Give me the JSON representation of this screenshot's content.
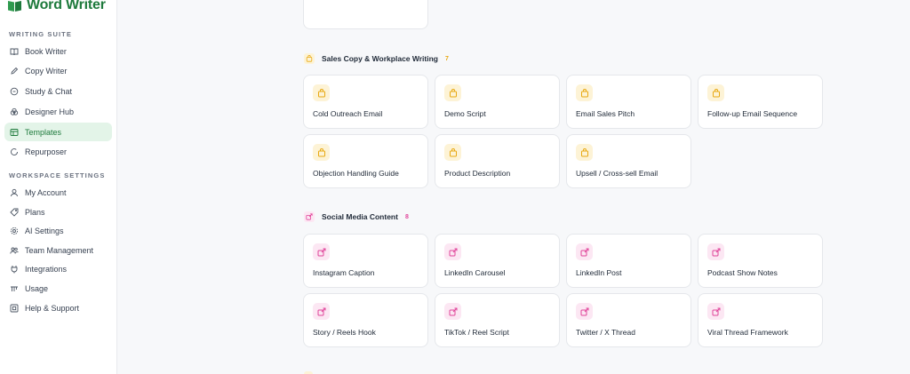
{
  "app": {
    "name": "Word Writer"
  },
  "sidebar": {
    "writing_suite_title": "WRITING SUITE",
    "writing_items": [
      {
        "label": "Book Writer",
        "icon": "book-icon"
      },
      {
        "label": "Copy Writer",
        "icon": "pen-icon"
      },
      {
        "label": "Study & Chat",
        "icon": "chat-icon"
      },
      {
        "label": "Designer Hub",
        "icon": "palette-icon"
      },
      {
        "label": "Templates",
        "icon": "template-icon",
        "active": true
      },
      {
        "label": "Repurposer",
        "icon": "refresh-icon"
      }
    ],
    "workspace_title": "WORKSPACE SETTINGS",
    "workspace_items": [
      {
        "label": "My Account",
        "icon": "user-icon"
      },
      {
        "label": "Plans",
        "icon": "tag-icon"
      },
      {
        "label": "AI Settings",
        "icon": "gear-icon"
      },
      {
        "label": "Team Management",
        "icon": "team-icon"
      },
      {
        "label": "Integrations",
        "icon": "plug-icon"
      },
      {
        "label": "Usage",
        "icon": "usage-icon"
      },
      {
        "label": "Help & Support",
        "icon": "help-icon"
      }
    ]
  },
  "sections": {
    "sales": {
      "title": "Sales Copy & Workplace Writing",
      "count": "7",
      "color": "#e8a812",
      "icon": "bag-icon",
      "items": [
        "Cold Outreach Email",
        "Demo Script",
        "Email Sales Pitch",
        "Follow-up Email Sequence",
        "Objection Handling Guide",
        "Product Description",
        "Upsell / Cross-sell Email"
      ]
    },
    "social": {
      "title": "Social Media Content",
      "count": "8",
      "color": "#e0449a",
      "icon": "share-icon",
      "items": [
        "Instagram Caption",
        "LinkedIn Carousel",
        "LinkedIn Post",
        "Podcast Show Notes",
        "Story / Reels Hook",
        "TikTok / Reel Script",
        "Twitter / X Thread",
        "Viral Thread Framework"
      ]
    }
  }
}
